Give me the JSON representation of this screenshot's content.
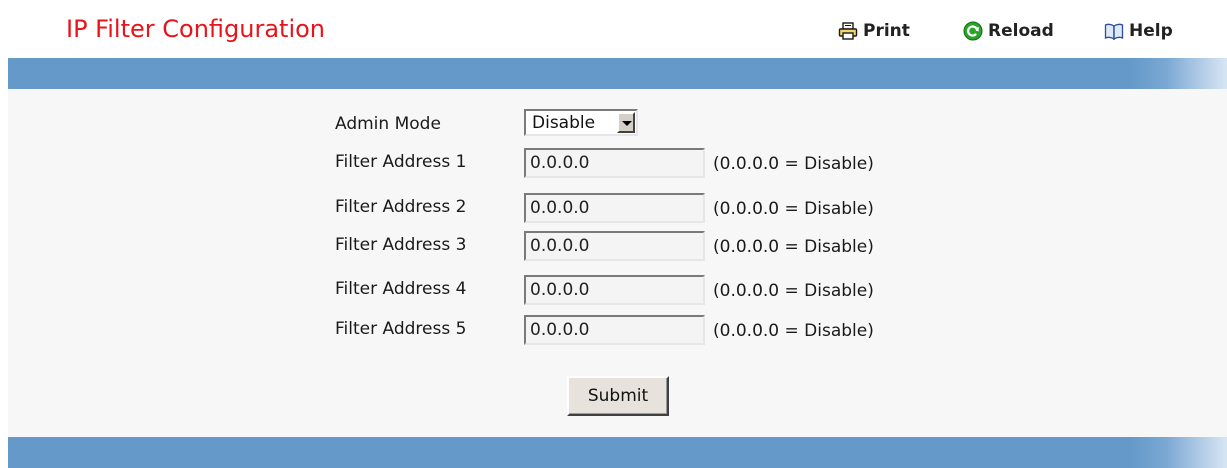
{
  "header": {
    "title": "IP Filter Configuration",
    "title_color": "#e8141a",
    "print_label": "Print",
    "reload_label": "Reload",
    "help_label": "Help"
  },
  "colors": {
    "bar": "#6499c9",
    "background": "#f7f7f7"
  },
  "form": {
    "admin_mode": {
      "label": "Admin Mode",
      "value": "Disable"
    },
    "filters": [
      {
        "label": "Filter Address 1",
        "value": "0.0.0.0",
        "hint": "(0.0.0.0 = Disable)"
      },
      {
        "label": "Filter Address 2",
        "value": "0.0.0.0",
        "hint": "(0.0.0.0 = Disable)"
      },
      {
        "label": "Filter Address 3",
        "value": "0.0.0.0",
        "hint": "(0.0.0.0 = Disable)"
      },
      {
        "label": "Filter Address 4",
        "value": "0.0.0.0",
        "hint": "(0.0.0.0 = Disable)"
      },
      {
        "label": "Filter Address 5",
        "value": "0.0.0.0",
        "hint": "(0.0.0.0 = Disable)"
      }
    ],
    "submit_label": "Submit"
  },
  "icons": {
    "print": "printer-icon",
    "reload": "reload-icon",
    "help": "help-book-icon"
  }
}
